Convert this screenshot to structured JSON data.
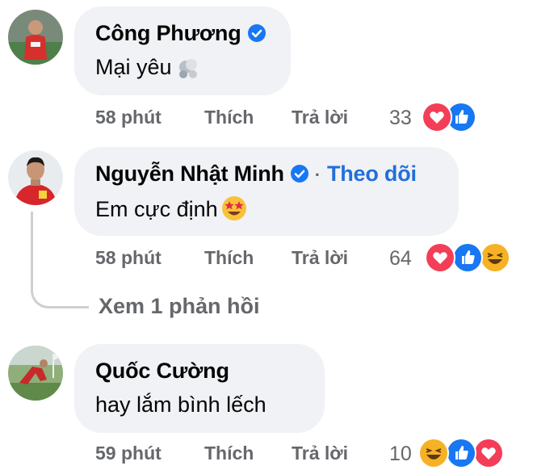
{
  "comments": [
    {
      "author": "Công Phương",
      "verified": true,
      "text": "Mại yêu",
      "time": "58 phút",
      "like_label": "Thích",
      "reply_label": "Trả lời",
      "reaction_count": "33",
      "reactions": [
        "love-icon",
        "like-icon"
      ]
    },
    {
      "author": "Nguyễn Nhật Minh",
      "verified": true,
      "separator": "·",
      "follow_label": "Theo dõi",
      "text": "Em cực định",
      "time": "58 phút",
      "like_label": "Thích",
      "reply_label": "Trả lời",
      "reaction_count": "64",
      "reactions": [
        "love-icon",
        "like-icon",
        "haha-icon"
      ],
      "view_replies": "Xem 1 phản hồi"
    },
    {
      "author": "Quốc Cường",
      "verified": false,
      "text": "hay lắm bình lếch",
      "time": "59 phút",
      "like_label": "Thích",
      "reply_label": "Trả lời",
      "reaction_count": "10",
      "reactions": [
        "haha-icon",
        "like-icon",
        "love-icon"
      ]
    }
  ],
  "colors": {
    "bubble": "#f0f2f5",
    "secondary_text": "#65676b",
    "link_blue": "#216fdb",
    "like_blue": "#1877f2",
    "love_red": "#f33e58",
    "haha_yellow": "#f7b125"
  }
}
